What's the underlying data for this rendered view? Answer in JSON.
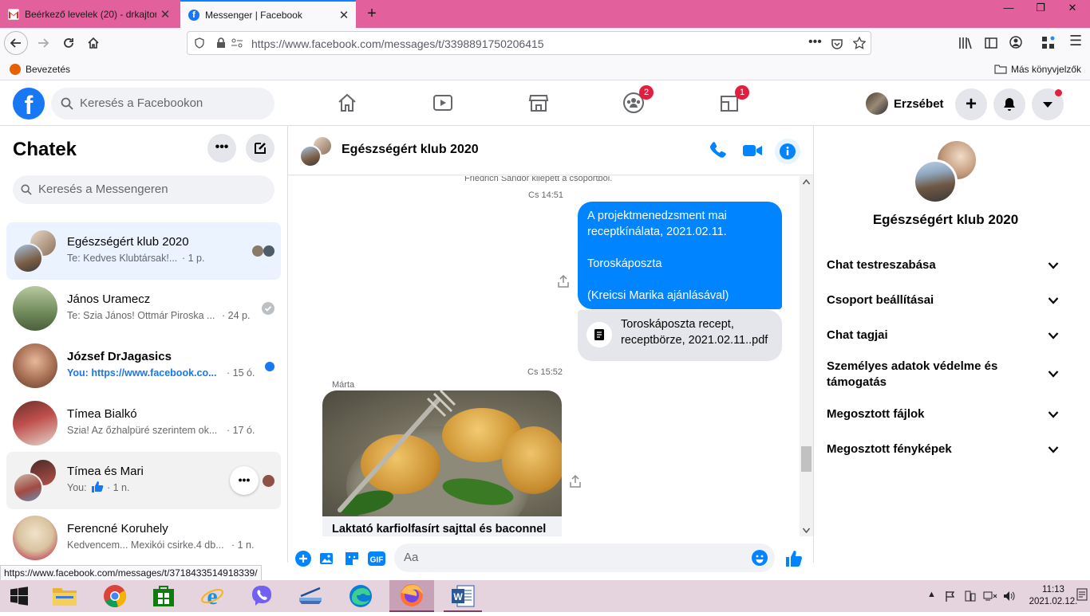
{
  "browser": {
    "tabs": [
      {
        "title": "Beérkező levelek (20) - drkajtor",
        "close": "✕"
      },
      {
        "title": "Messenger | Facebook",
        "close": "✕"
      }
    ],
    "new_tab": "+",
    "url": "https://www.facebook.com/messages/t/3398891750206415",
    "bookmarks": {
      "left": "Bevezetés",
      "right": "Más könyvjelzők"
    },
    "window_controls": [
      "—",
      "❐",
      "✕"
    ]
  },
  "facebook": {
    "search_placeholder": "Keresés a Facebookon",
    "nav_badges": {
      "groups": "2",
      "gaming": "1"
    },
    "user_name": "Erzsébet"
  },
  "chats": {
    "title": "Chatek",
    "search_placeholder": "Keresés a Messengeren",
    "conversations": [
      {
        "name": "Egészségért klub 2020",
        "snippet": "Te: Kedves Klubtársak!...",
        "time": "· 1 p."
      },
      {
        "name": "János Uramecz",
        "snippet": "Te: Szia János! Ottmár Piroska ...",
        "time": "· 24 p."
      },
      {
        "name": "József DrJagasics",
        "snippet": "You: https://www.facebook.co...",
        "time": "· 15 ó."
      },
      {
        "name": "Tímea Bialkó",
        "snippet": "Szia! Az őzhalpüré szerintem ok...",
        "time": "· 17 ó."
      },
      {
        "name": "Tímea és Mari",
        "snippet": "You:",
        "time": "· 1 n."
      },
      {
        "name": "Ferencné Koruhely",
        "snippet": "Kedvencem... Mexikói csirke.4 db...",
        "time": "· 1 n."
      }
    ]
  },
  "chat": {
    "title": "Egészségért klub 2020",
    "system_msg": "Friedrich Sándor kilépett a csoportból.",
    "time1": "Cs 14:51",
    "bubble_lines": [
      "A projektmenedzsment mai",
      "receptkínálata, 2021.02.11.",
      "",
      "Toroskáposzta",
      "",
      "(Kreicsi Marika ajánlásával)"
    ],
    "file_lines": [
      "Toroskáposzta recept,",
      "receptbörze, 2021.02.11..pdf"
    ],
    "time2": "Cs 15:52",
    "sender": "Márta",
    "link_title": "Laktató karfiolfasírt sajttal és baconnel",
    "composer_placeholder": "Aa"
  },
  "info_panel": {
    "title": "Egészségért klub 2020",
    "items": [
      "Chat testreszabása",
      "Csoport beállításai",
      "Chat tagjai",
      "Személyes adatok védelme és támogatás",
      "Megosztott fájlok",
      "Megosztott fényképek"
    ]
  },
  "status_url": "https://www.facebook.com/messages/t/3718433514918339/",
  "taskbar": {
    "time": "11:13",
    "date": "2021.02.12."
  },
  "colors": {
    "fb_blue": "#1877f2",
    "messenger_blue": "#0084ff",
    "tabbar_pink": "#e2609b",
    "badge_red": "#e41e3f"
  }
}
